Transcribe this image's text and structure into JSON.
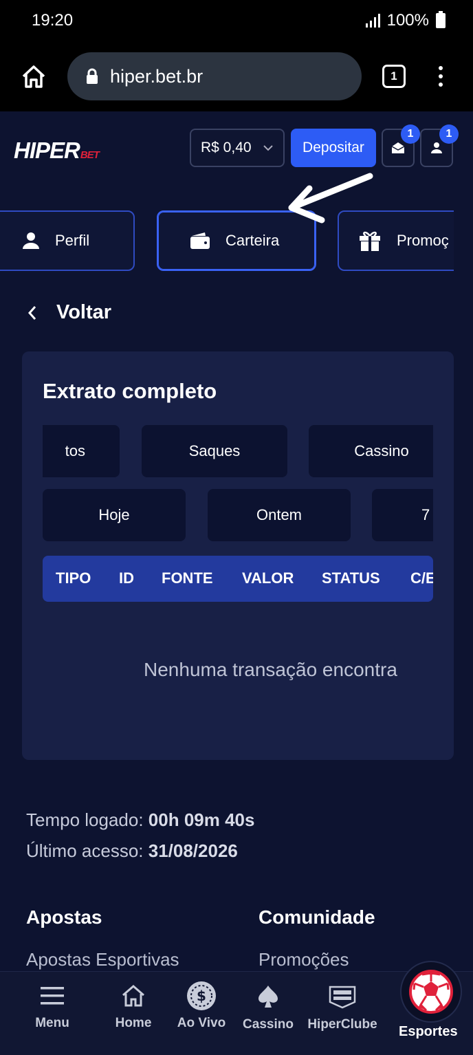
{
  "status_bar": {
    "time": "19:20",
    "battery": "100%"
  },
  "browser": {
    "url": "hiper.bet.br",
    "tab_count": "1"
  },
  "header": {
    "logo_main": "HIPER",
    "logo_sub": "BET",
    "balance": "R$ 0,40",
    "deposit_label": "Depositar",
    "mail_badge": "1",
    "user_badge": "1"
  },
  "account_tabs": [
    {
      "label": "Perfil",
      "icon": "user-icon"
    },
    {
      "label": "Carteira",
      "icon": "wallet-icon"
    },
    {
      "label": "Promoç",
      "icon": "gift-icon"
    }
  ],
  "back_label": "Voltar",
  "statement": {
    "title": "Extrato completo",
    "type_filters": [
      "tos",
      "Saques",
      "Cassino"
    ],
    "date_filters": [
      "Hoje",
      "Ontem",
      "7"
    ],
    "columns": [
      "TIPO",
      "ID",
      "FONTE",
      "VALOR",
      "STATUS",
      "C/E"
    ],
    "empty_message": "Nenhuma transação encontra"
  },
  "session": {
    "logged_label": "Tempo logado:",
    "logged_value": "00h 09m 40s",
    "last_label": "Último acesso:",
    "last_value": "31/08/2026"
  },
  "footer": {
    "col1_title": "Apostas",
    "col1_link": "Apostas Esportivas",
    "col2_title": "Comunidade",
    "col2_link": "Promoções"
  },
  "bottom_nav": [
    {
      "label": "Menu",
      "icon": "menu-icon"
    },
    {
      "label": "Home",
      "icon": "home-icon"
    },
    {
      "label": "Ao Vivo",
      "icon": "live-coin-icon"
    },
    {
      "label": "Cassino",
      "icon": "spade-icon"
    },
    {
      "label": "HiperClube",
      "icon": "hiperclube-icon"
    },
    {
      "label": "Esportes",
      "icon": "soccer-ball-icon"
    }
  ],
  "colors": {
    "accent": "#2d5cf5",
    "background": "#0d1330",
    "card": "#182046",
    "brand_red": "#e0213a"
  }
}
